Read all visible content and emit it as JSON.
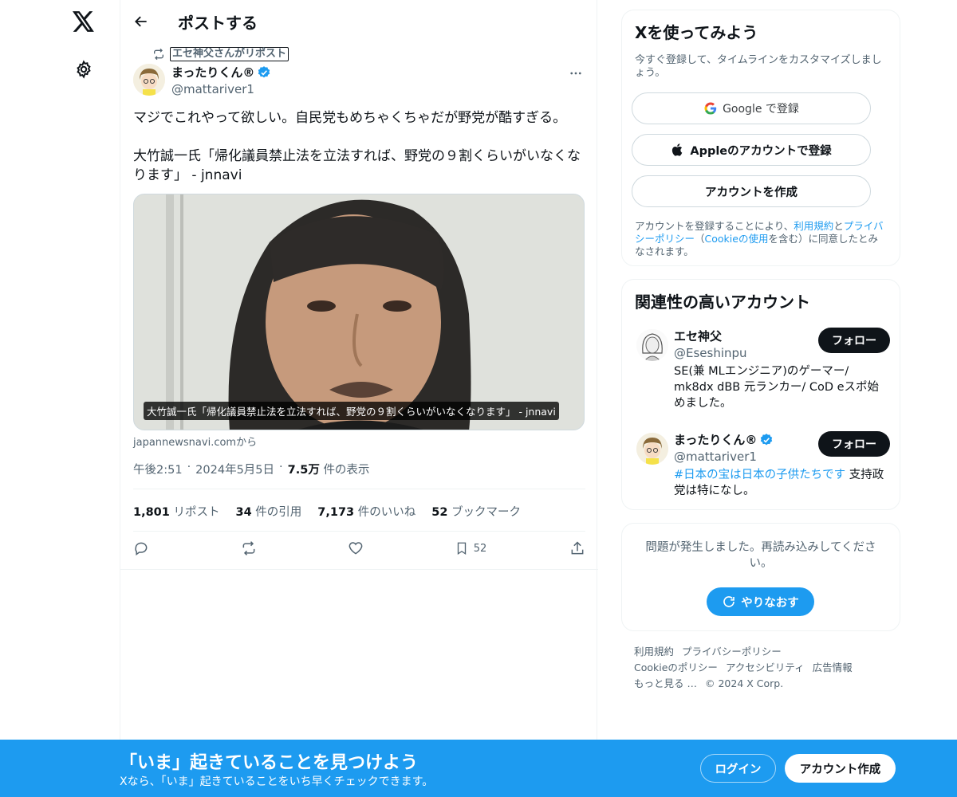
{
  "header": {
    "title": "ポストする"
  },
  "tweet": {
    "repost_label": "エセ神父さんがリポスト",
    "author_name": "まったりくん®",
    "author_handle": "@mattariver1",
    "text": "マジでこれやって欲しい。自民党もめちゃくちゃだが野党が酷すぎる。\n\n大竹誠一氏「帰化議員禁止法を立法すれば、野党の９割くらいがいなくなります」 - jnnavi",
    "media_caption": "大竹誠一氏「帰化議員禁止法を立法すれば、野党の９割くらいがいなくなります」 - jnnavi",
    "media_source": "japannewsnavi.comから",
    "time": "午後2:51",
    "date": "2024年5月5日",
    "views": "7.5万",
    "views_label": "件の表示",
    "stats": {
      "reposts": "1,801",
      "reposts_label": "リポスト",
      "quotes": "34",
      "quotes_label": "件の引用",
      "likes": "7,173",
      "likes_label": "件のいいね",
      "bookmarks": "52",
      "bookmarks_label": "ブックマーク"
    },
    "bookmark_count": "52"
  },
  "signup": {
    "title": "Xを使ってみよう",
    "subtitle": "今すぐ登録して、タイムラインをカスタマイズしましょう。",
    "google": "Google で登録",
    "apple": "Appleのアカウントで登録",
    "create": "アカウントを作成",
    "terms_1": "アカウントを登録することにより、",
    "terms_link1": "利用規約",
    "terms_2": "と",
    "terms_link2": "プライバシーポリシー",
    "terms_3": "（",
    "terms_link3": "Cookieの使用",
    "terms_4": "を含む）に同意したとみなされます。"
  },
  "related": {
    "title": "関連性の高いアカウント",
    "accounts": [
      {
        "name": "エセ神父",
        "handle": "@Eseshinpu",
        "bio": "SE(兼 MLエンジニア)のゲーマー/ mk8dx dBB 元ランカー/ CoD eスポ始めました。",
        "follow": "フォロー"
      },
      {
        "name": "まったりくん®",
        "handle": "@mattariver1",
        "bio_hash": "#日本の宝は日本の子供たちです",
        "bio_rest": " 支持政党は特になし。",
        "follow": "フォロー"
      }
    ]
  },
  "error": {
    "text": "問題が発生しました。再読み込みしてください。",
    "retry": "やりなおす"
  },
  "footer": {
    "links": [
      "利用規約",
      "プライバシーポリシー",
      "Cookieのポリシー",
      "アクセシビリティ",
      "広告情報",
      "もっと見る …",
      "© 2024 X Corp."
    ]
  },
  "bottombar": {
    "title": "「いま」起きていることを見つけよう",
    "subtitle": "Xなら、「いま」起きていることをいち早くチェックできます。",
    "login": "ログイン",
    "create": "アカウント作成"
  },
  "colors": {
    "accent": "#1d9bf0",
    "text": "#0f1419",
    "muted": "#536471",
    "border": "#eff3f4"
  }
}
